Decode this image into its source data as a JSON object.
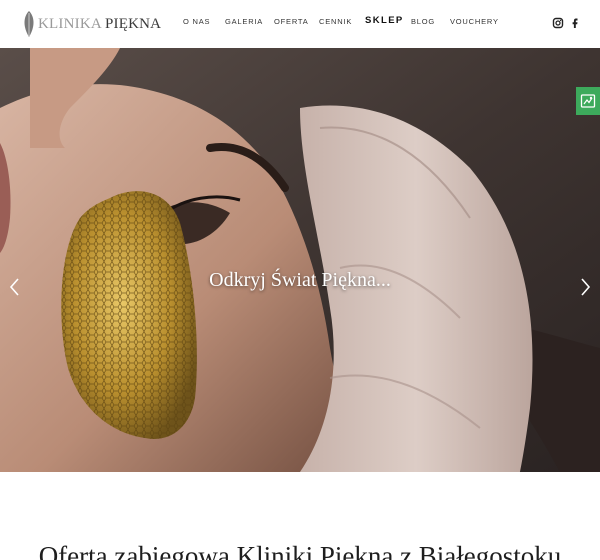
{
  "brand": {
    "logo_part1": "KLINIKA",
    "logo_part2": "PIĘKNA",
    "logo_icon": "leaf-icon"
  },
  "nav": {
    "items": [
      {
        "label": "O NAS"
      },
      {
        "label": "GALERIA"
      },
      {
        "label": "OFERTA"
      },
      {
        "label": "CENNIK"
      },
      {
        "label": "SKLEP"
      },
      {
        "label": "BLOG"
      },
      {
        "label": "VOUCHERY"
      }
    ]
  },
  "social": {
    "instagram": "instagram-icon",
    "facebook": "facebook-icon"
  },
  "hero": {
    "caption": "Odkryj Świat Piękna...",
    "prev_icon": "chevron-left-icon",
    "next_icon": "chevron-right-icon"
  },
  "side_badge": {
    "icon": "map-icon",
    "color": "#3daa5c"
  },
  "section": {
    "title": "Oferta zabiegowa Kliniki Piękna z Białegostoku"
  }
}
